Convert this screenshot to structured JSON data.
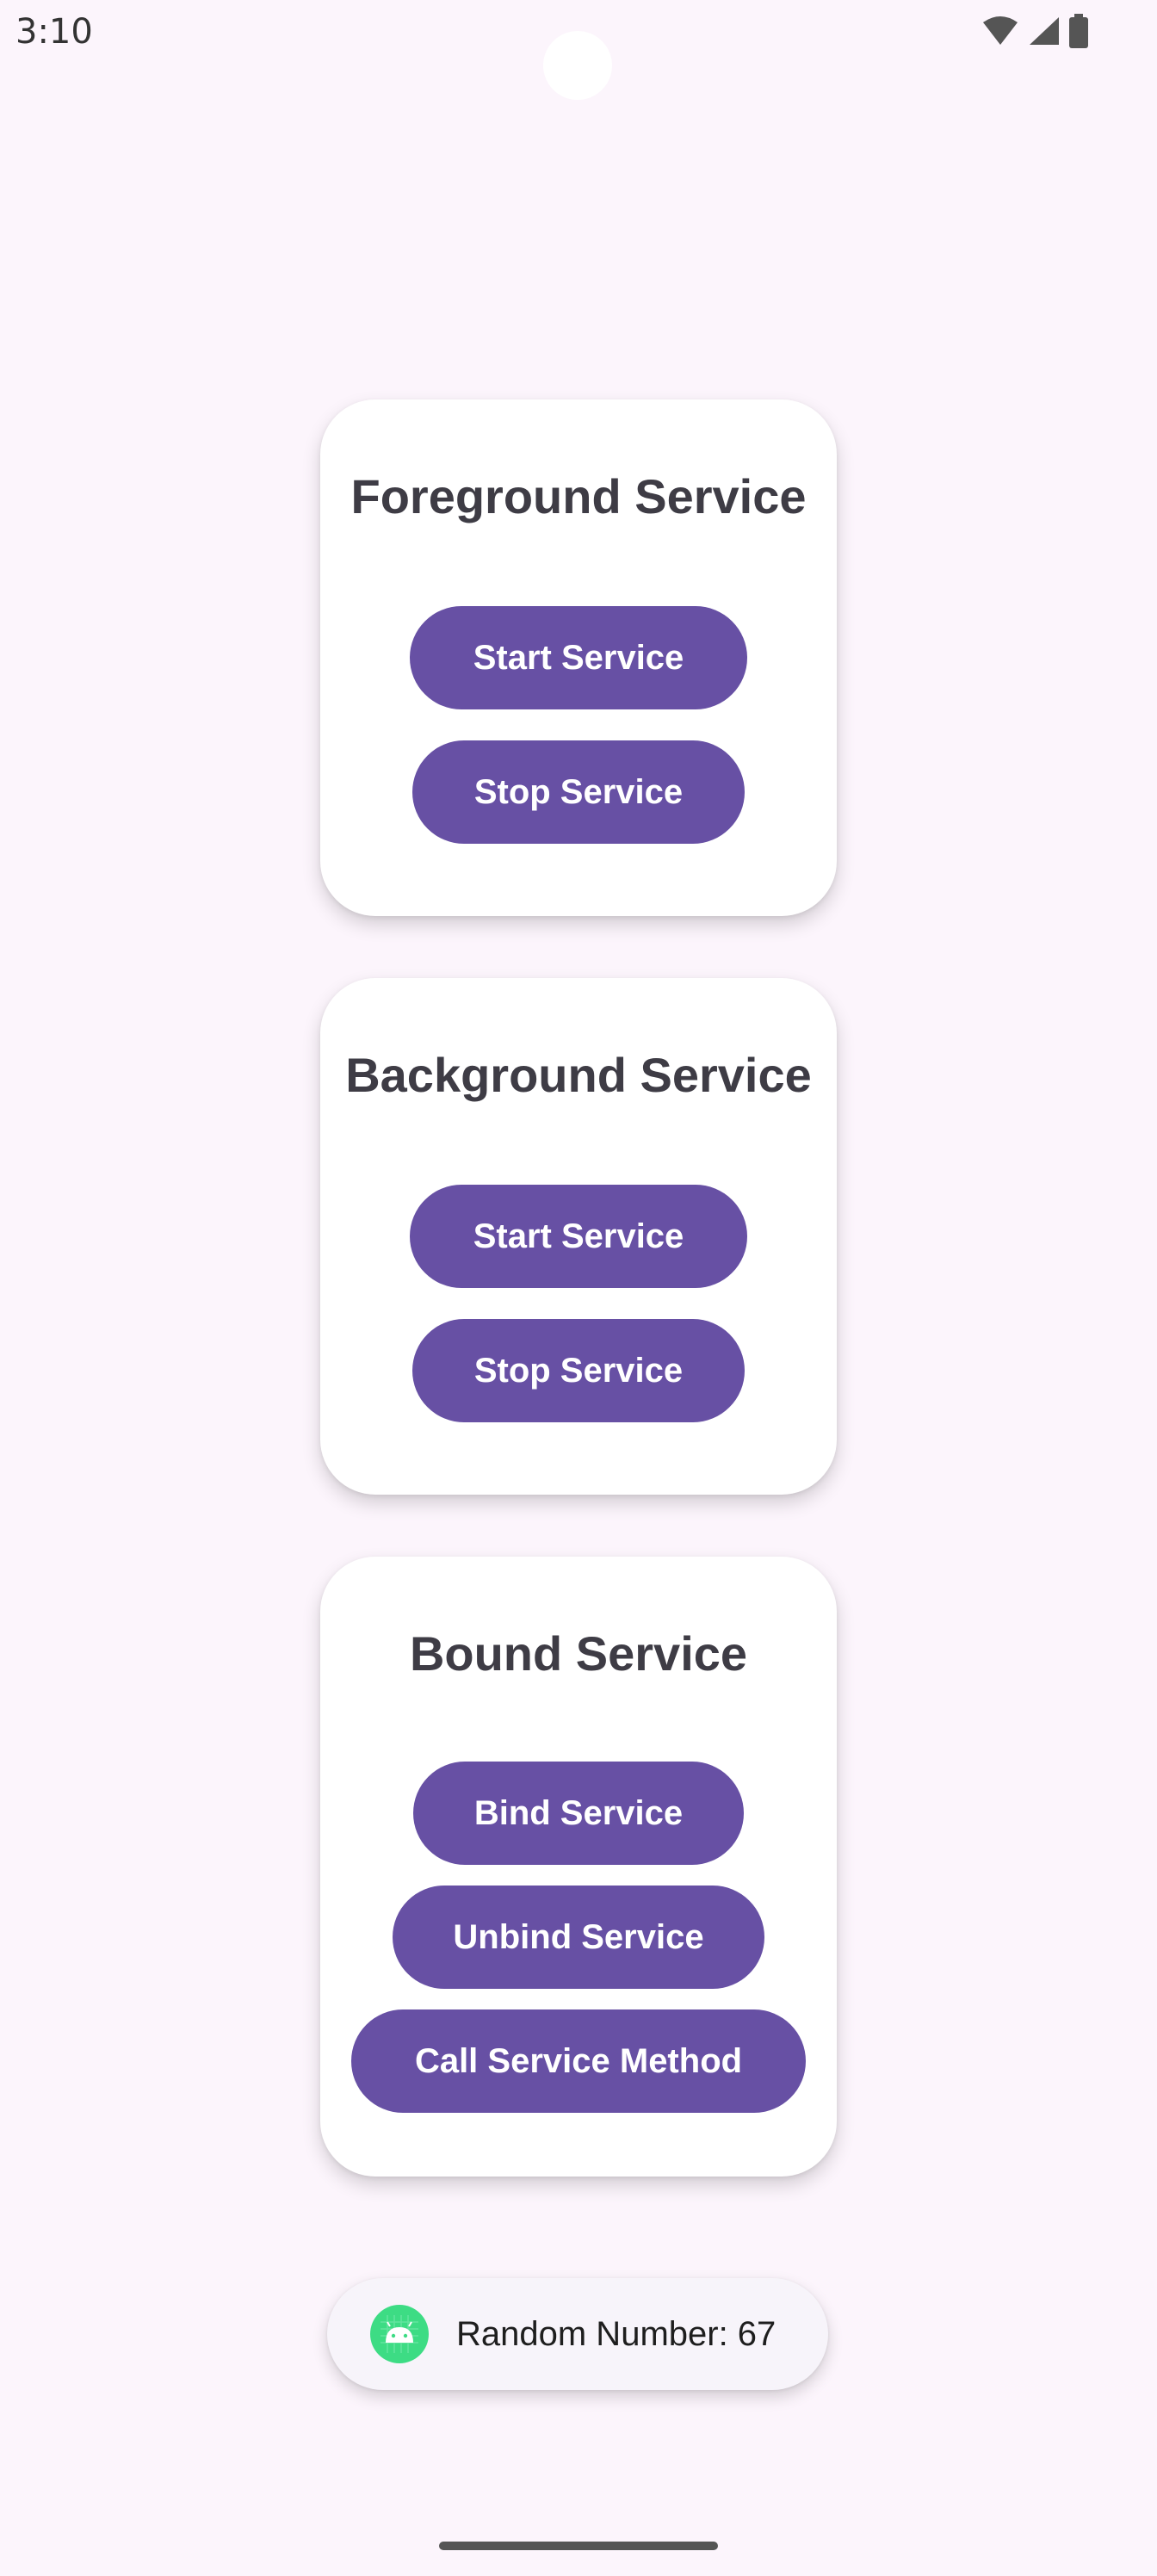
{
  "status_bar": {
    "time": "3:10",
    "icons": [
      "wifi-icon",
      "cell-signal-icon",
      "battery-icon"
    ]
  },
  "cards": [
    {
      "title": "Foreground Service",
      "buttons": [
        "Start Service",
        "Stop Service"
      ]
    },
    {
      "title": "Background Service",
      "buttons": [
        "Start Service",
        "Stop Service"
      ]
    },
    {
      "title": "Bound Service",
      "buttons": [
        "Bind Service",
        "Unbind Service",
        "Call Service Method"
      ]
    }
  ],
  "toast": {
    "icon": "android-app-icon",
    "text": "Random Number: 67"
  },
  "colors": {
    "background": "#FCF5FC",
    "card": "#FFFFFF",
    "button": "#6750A4",
    "button_text": "#FFFFFF",
    "title": "#3E3C45",
    "toast_icon": "#3DDC84"
  }
}
